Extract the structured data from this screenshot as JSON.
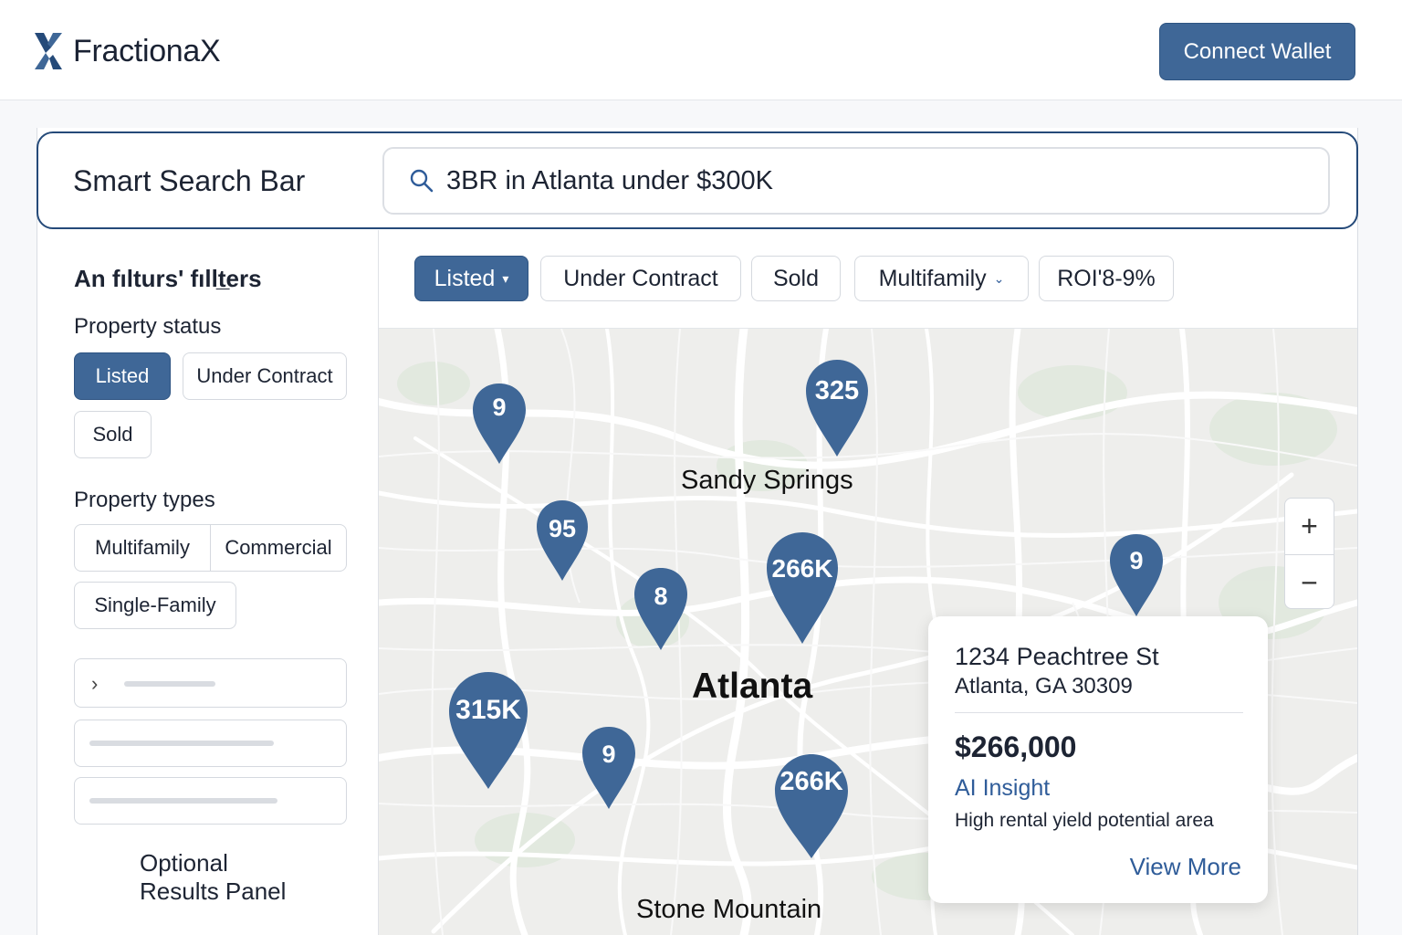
{
  "header": {
    "brand": "FractionaX",
    "connect_label": "Connect Wallet"
  },
  "search": {
    "title": "Smart Search Bar",
    "query": "3BR in Atlanta under $300K"
  },
  "sidebar": {
    "heading": "An fılturs' fıllt̲ers",
    "status_label": "Property status",
    "status_options": [
      "Listed",
      "Under Contract",
      "Sold"
    ],
    "types_label": "Property types",
    "type_options": [
      "Multifamily",
      "Commercial",
      "Single-Family"
    ],
    "optional_panel": [
      "Optional",
      "Results Panel"
    ]
  },
  "filters": [
    {
      "label": "Listed",
      "active": true,
      "caret": true
    },
    {
      "label": "Under Contract",
      "active": false
    },
    {
      "label": "Sold",
      "active": false
    },
    {
      "label": "Multifamily",
      "active": false,
      "caret": true
    },
    {
      "label": "ROI'8-9%",
      "active": false
    }
  ],
  "map": {
    "cities": [
      "Sandy Springs",
      "Atlanta",
      "Stone Mountain"
    ],
    "pins": [
      "9",
      "325",
      "95",
      "8",
      "266K",
      "9",
      "315K",
      "9",
      "266K"
    ],
    "zoom_in": "+",
    "zoom_out": "−"
  },
  "popup": {
    "address_line1": "1234 Peachtree St",
    "address_line2": "Atlanta, GA 30309",
    "price": "$266,000",
    "ai_label": "AI Insight",
    "ai_text": "High rental yield potential area",
    "view_more": "View More"
  },
  "colors": {
    "primary": "#3f6797",
    "border_dark": "#254a79",
    "link": "#2f5c99",
    "map_bg": "#eeeeec"
  }
}
